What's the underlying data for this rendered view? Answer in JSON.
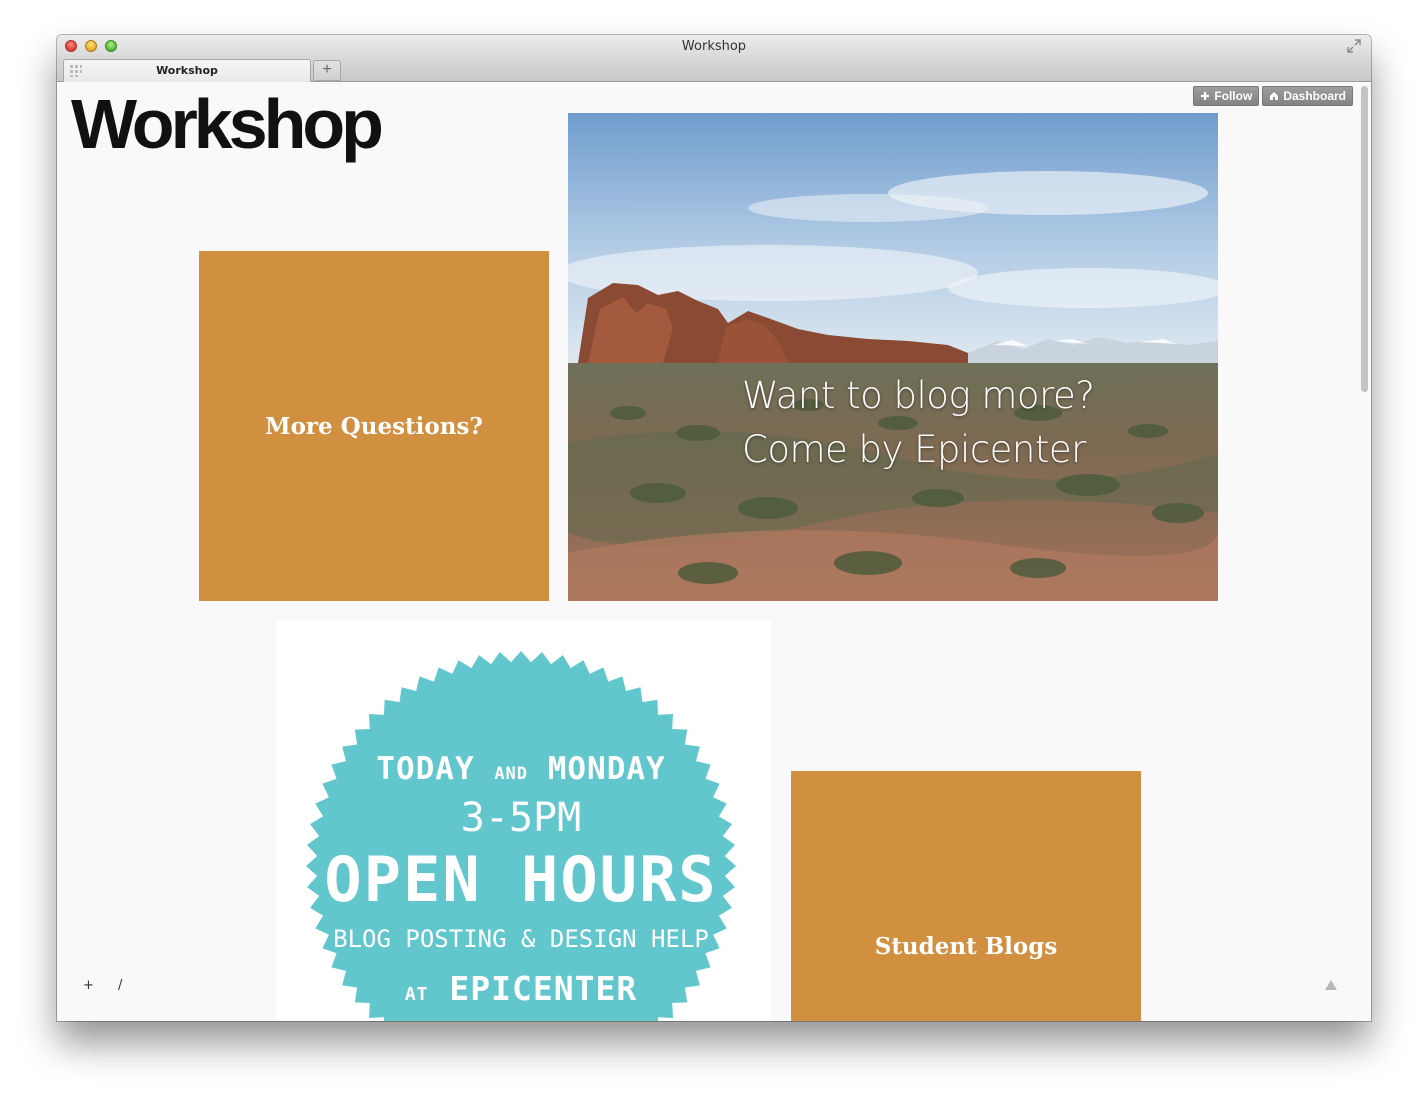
{
  "window": {
    "title": "Workshop",
    "tab_label": "Workshop",
    "new_tab_symbol": "+"
  },
  "blog": {
    "title": "Workshop"
  },
  "controls": {
    "follow_label": "Follow",
    "dashboard_label": "Dashboard"
  },
  "posts": {
    "more_questions": "More Questions?",
    "photo_caption_line1": "Want to blog more?",
    "photo_caption_line2": "Come by Epicenter",
    "badge": {
      "line1_a": "TODAY",
      "line1_b": "AND",
      "line1_c": "MONDAY",
      "time": "3-5PM",
      "headline": "OPEN HOURS",
      "subline": "BLOG POSTING & DESIGN HELP",
      "at": "AT",
      "place": "EPICENTER"
    },
    "student_blogs": "Student Blogs"
  },
  "footer": {
    "plus": "+",
    "slash": "/"
  },
  "colors": {
    "tile": "#d18f40",
    "badge": "#62c6cd",
    "sky_top": "#7ea6d2",
    "desert": "#9c6a48"
  }
}
